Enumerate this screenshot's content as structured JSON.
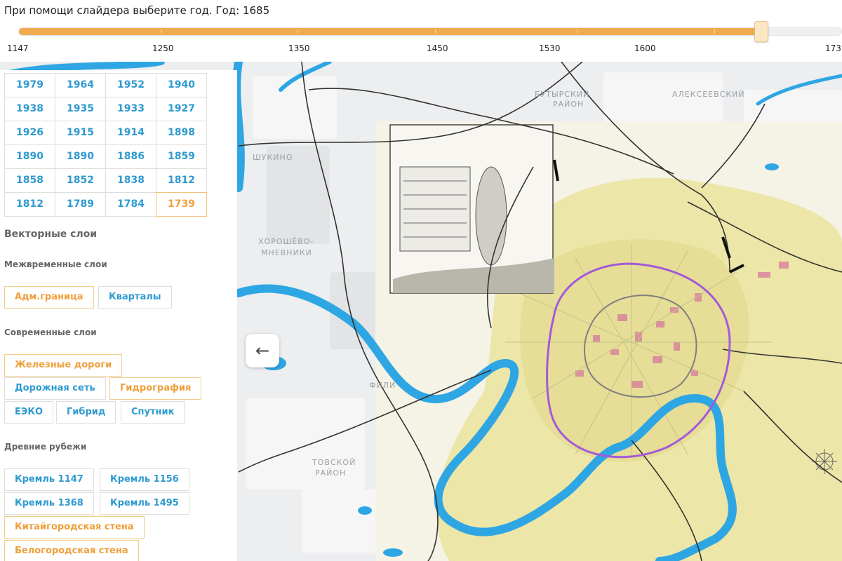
{
  "slider": {
    "prompt": "При помощи слайдера выберите год. Год: 1685",
    "value_fraction": 0.902,
    "ticks": [
      "1147",
      "1250",
      "1350",
      "1450",
      "1530",
      "1600",
      "173"
    ]
  },
  "panel": {
    "year_buttons": [
      {
        "label": "1979",
        "active": false
      },
      {
        "label": "1964",
        "active": false
      },
      {
        "label": "1952",
        "active": false
      },
      {
        "label": "1940",
        "active": false
      },
      {
        "label": "1938",
        "active": false
      },
      {
        "label": "1935",
        "active": false
      },
      {
        "label": "1933",
        "active": false
      },
      {
        "label": "1927",
        "active": false
      },
      {
        "label": "1926",
        "active": false
      },
      {
        "label": "1915",
        "active": false
      },
      {
        "label": "1914",
        "active": false
      },
      {
        "label": "1898",
        "active": false
      },
      {
        "label": "1890",
        "active": false
      },
      {
        "label": "1890",
        "active": false
      },
      {
        "label": "1886",
        "active": false
      },
      {
        "label": "1859",
        "active": false
      },
      {
        "label": "1858",
        "active": false
      },
      {
        "label": "1852",
        "active": false
      },
      {
        "label": "1838",
        "active": false
      },
      {
        "label": "1812",
        "active": false
      },
      {
        "label": "1812",
        "active": false
      },
      {
        "label": "1789",
        "active": false
      },
      {
        "label": "1784",
        "active": false
      },
      {
        "label": "1739",
        "active": true
      }
    ],
    "vector_title": "Векторные слои",
    "intertemporal": {
      "title": "Межвременные слои",
      "buttons": [
        {
          "label": "Адм.граница",
          "active": true
        },
        {
          "label": "Кварталы",
          "active": false
        }
      ]
    },
    "modern": {
      "title": "Современные слои",
      "buttons": [
        {
          "label": "Железные дороги",
          "active": true
        },
        {
          "label": "Дорожная сеть",
          "active": false
        },
        {
          "label": "Гидрография",
          "active": true
        },
        {
          "label": "ЕЭКО",
          "active": false
        },
        {
          "label": "Гибрид",
          "active": false
        },
        {
          "label": "Спутник",
          "active": false
        }
      ]
    },
    "ancient": {
      "title": "Древние рубежи",
      "buttons": [
        {
          "label": "Кремль 1147",
          "active": false
        },
        {
          "label": "Кремль 1156",
          "active": false
        },
        {
          "label": "Кремль 1368",
          "active": false
        },
        {
          "label": "Кремль 1495",
          "active": false
        },
        {
          "label": "Китайгородская стена",
          "active": true
        },
        {
          "label": "Белогородская стена",
          "active": true
        }
      ]
    }
  },
  "map": {
    "back_arrow": "←",
    "labels": {
      "d1": "БУТЫРСКИЙ",
      "d2": "РАЙОН",
      "d3": "АЛЕКСЕЕВСКИЙ",
      "d4": "ХОРОШЁВО-",
      "d5": "МНЕВНИКИ",
      "d6": "ФИЛИ",
      "d7": "ШУКИНО",
      "d8": "ТОВСКОЙ",
      "d9": "РАЙОН"
    },
    "colors": {
      "river": "#2ea6e3",
      "boundary": "#a45ad8",
      "old_map": "#efeab8",
      "accent": "#f0ab4e",
      "link": "#2f9ad0"
    }
  }
}
